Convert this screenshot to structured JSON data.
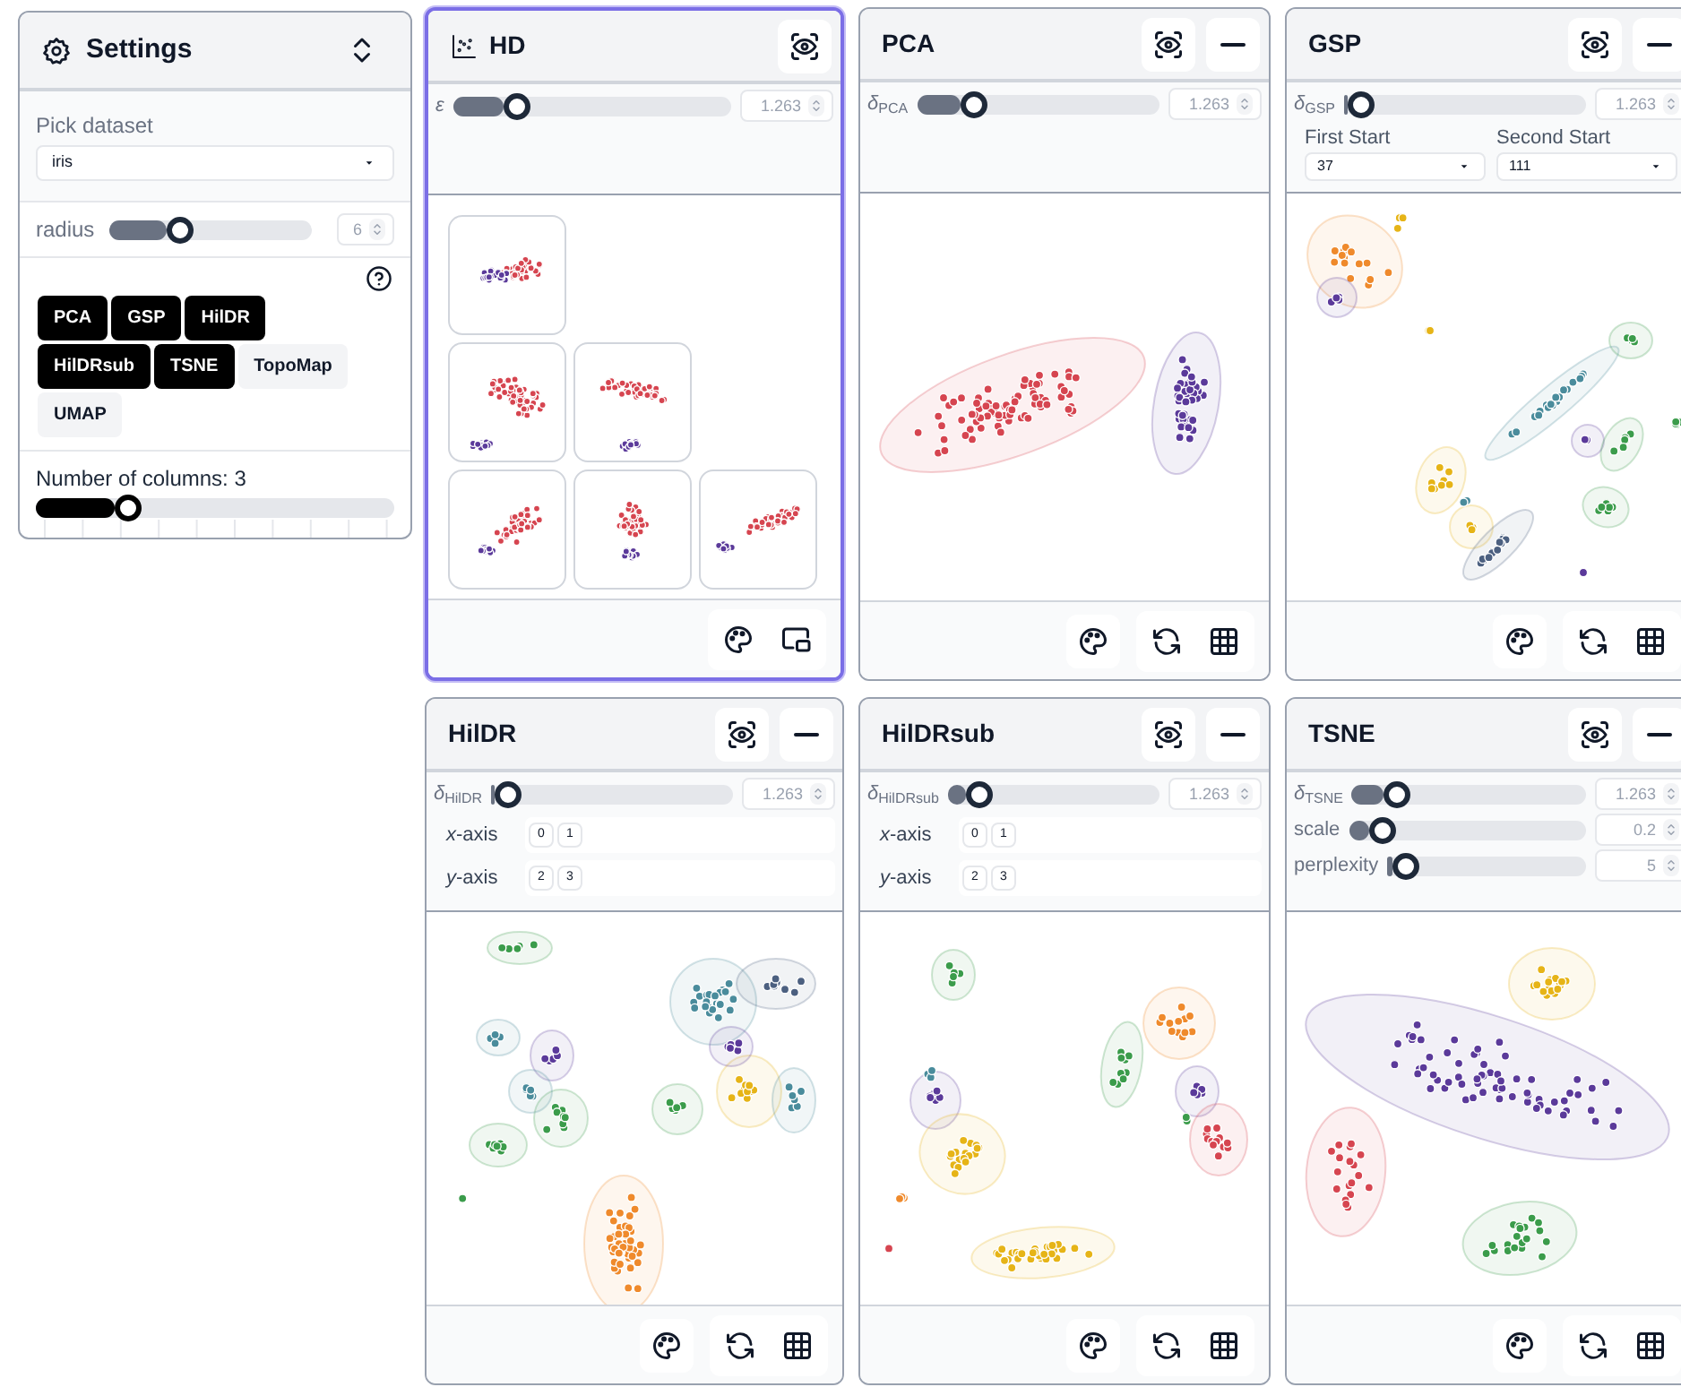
{
  "settings": {
    "title": "Settings",
    "dataset": {
      "label": "Pick dataset",
      "value": "iris"
    },
    "radius": {
      "label": "radius",
      "level": 0.33,
      "value": "6"
    },
    "methods": [
      {
        "label": "PCA",
        "selected": true
      },
      {
        "label": "GSP",
        "selected": true
      },
      {
        "label": "HilDR",
        "selected": true
      },
      {
        "label": "HilDRsub",
        "selected": true
      },
      {
        "label": "TSNE",
        "selected": true
      },
      {
        "label": "TopoMap",
        "selected": false
      },
      {
        "label": "UMAP",
        "selected": false
      }
    ],
    "columns": {
      "label": "Number of columns: 3",
      "level": 0.24
    }
  },
  "panels": [
    {
      "title": "HD",
      "kind": "matrix",
      "selected": true,
      "minimizable": false,
      "controls": [
        {
          "kind": "slider",
          "label": "*ε*",
          "level": 0.2,
          "value": "1.263"
        }
      ]
    },
    {
      "title": "PCA",
      "kind": "embedding",
      "selected": false,
      "minimizable": true,
      "controls": [
        {
          "kind": "slider",
          "label": "*δ*$_{PCA}$",
          "level": 0.2,
          "value": "1.263"
        }
      ]
    },
    {
      "title": "GSP",
      "kind": "embedding",
      "selected": false,
      "minimizable": true,
      "controls": [
        {
          "kind": "slider",
          "label": "*δ*$_{GSP}$",
          "level": 0.02,
          "value": "1.263"
        },
        {
          "kind": "selects",
          "items": [
            {
              "label": "First Start",
              "value": "37"
            },
            {
              "label": "Second Start",
              "value": "111"
            }
          ]
        }
      ]
    },
    {
      "title": "HilDR",
      "kind": "embedding",
      "selected": false,
      "minimizable": true,
      "controls": [
        {
          "kind": "slider",
          "label": "*δ*$_{HilDR}$",
          "level": 0.02,
          "value": "1.263"
        },
        {
          "kind": "axis",
          "label": "*x*-axis",
          "values": [
            "0",
            "1"
          ]
        },
        {
          "kind": "axis",
          "label": "*y*-axis",
          "values": [
            "2",
            "3"
          ]
        }
      ]
    },
    {
      "title": "HilDRsub",
      "kind": "embedding",
      "selected": false,
      "minimizable": true,
      "controls": [
        {
          "kind": "slider",
          "label": "*δ*$_{HilDRsub}$",
          "level": 0.1,
          "value": "1.263"
        },
        {
          "kind": "axis",
          "label": "*x*-axis",
          "values": [
            "0",
            "1"
          ]
        },
        {
          "kind": "axis",
          "label": "*y*-axis",
          "values": [
            "2",
            "3"
          ]
        }
      ]
    },
    {
      "title": "TSNE",
      "kind": "embedding",
      "selected": false,
      "minimizable": true,
      "controls": [
        {
          "kind": "slider",
          "label": "*δ*$_{TSNE}$",
          "level": 0.15,
          "value": "1.263"
        },
        {
          "kind": "slider",
          "label": "scale",
          "level": 0.1,
          "value": "0.2"
        },
        {
          "kind": "slider",
          "label": "perplexity",
          "level": 0.03,
          "value": "5"
        }
      ]
    }
  ]
}
